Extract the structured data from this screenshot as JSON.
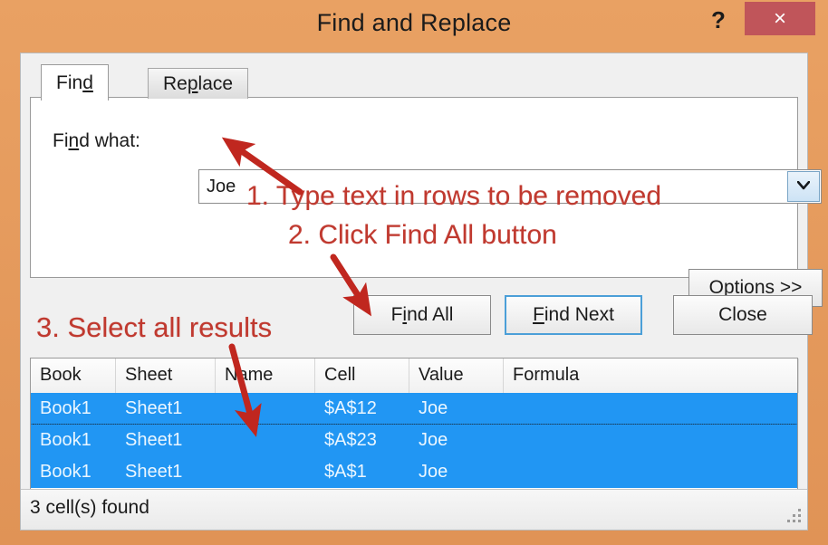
{
  "window": {
    "title": "Find and Replace",
    "help_glyph": "?",
    "close_glyph": "×",
    "frame_color": "#e09356",
    "close_color": "#c0555a"
  },
  "tabs": [
    {
      "label": "Find",
      "accel_index": 3,
      "active": true
    },
    {
      "label": "Replace",
      "accel_index": 2,
      "active": false
    }
  ],
  "find_panel": {
    "find_what_label": "Find what:",
    "find_what_value": "Joe",
    "find_what_placeholder": "",
    "dropdown_icon": "chevron-down-icon",
    "options_label": "Options >>"
  },
  "buttons": {
    "find_all": "Find All",
    "find_next": "Find Next",
    "close": "Close",
    "default_button": "Find Next",
    "default_border_color": "#4b9fd8"
  },
  "results": {
    "columns": [
      "Book",
      "Sheet",
      "Name",
      "Cell",
      "Value",
      "Formula"
    ],
    "selection_color": "#2196f3",
    "rows": [
      {
        "book": "Book1",
        "sheet": "Sheet1",
        "name": "",
        "cell": "$A$12",
        "value": "Joe",
        "formula": "",
        "selected": true
      },
      {
        "book": "Book1",
        "sheet": "Sheet1",
        "name": "",
        "cell": "$A$23",
        "value": "Joe",
        "formula": "",
        "selected": true
      },
      {
        "book": "Book1",
        "sheet": "Sheet1",
        "name": "",
        "cell": "$A$1",
        "value": "Joe",
        "formula": "",
        "selected": true
      }
    ]
  },
  "status": {
    "text": "3 cell(s) found",
    "grip_icon": "resize-grip-icon"
  },
  "annotations": {
    "color": "#c0392f",
    "step1": "1. Type text in rows to be removed",
    "step2": "2. Click Find All button",
    "step3": "3. Select all results",
    "arrows": [
      {
        "name": "arrow-to-find-what-field"
      },
      {
        "name": "arrow-to-find-all-button"
      },
      {
        "name": "arrow-to-results-rows"
      }
    ]
  }
}
